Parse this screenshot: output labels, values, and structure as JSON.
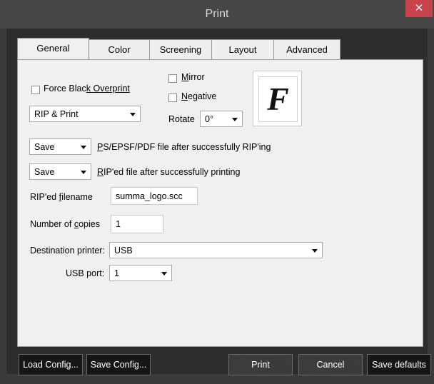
{
  "window": {
    "title": "Print",
    "close_glyph": "✕"
  },
  "tabs": [
    {
      "label": "General",
      "active": true
    },
    {
      "label": "Color",
      "active": false
    },
    {
      "label": "Screening",
      "active": false
    },
    {
      "label": "Layout",
      "active": false
    },
    {
      "label": "Advanced",
      "active": false
    }
  ],
  "general": {
    "force_black_overprint": {
      "label_pre": "Force Blac",
      "label_u": "k",
      "label_post": " Overprint",
      "checked": false
    },
    "mirror": {
      "label_u": "M",
      "label_post": "irror",
      "checked": false
    },
    "negative": {
      "label_u": "N",
      "label_post": "egative",
      "checked": false
    },
    "mode_select": {
      "value": "RIP & Print"
    },
    "rotate": {
      "label": "Rotate",
      "value": "0°"
    },
    "preview_letter": "F",
    "save_ps": {
      "value": "Save",
      "label_u": "P",
      "label_post": "S/EPSF/PDF file after successfully RIP'ing"
    },
    "save_riped": {
      "value": "Save",
      "label_u": "R",
      "label_post": "IP'ed file after successfully printing"
    },
    "riped_filename": {
      "label_pre": "RIP'ed ",
      "label_u": "f",
      "label_post": "ilename",
      "value": "summa_logo.scc"
    },
    "copies": {
      "label_pre": "Number of ",
      "label_u": "c",
      "label_post": "opies",
      "value": "1"
    },
    "destination": {
      "label": "Destination printer:",
      "value": "USB"
    },
    "usb_port": {
      "label": "USB port:",
      "value": "1"
    }
  },
  "buttons": {
    "load_config": "Load Config...",
    "save_config": "Save Config...",
    "print": "Print",
    "cancel": "Cancel",
    "save_defaults": "Save defaults"
  }
}
